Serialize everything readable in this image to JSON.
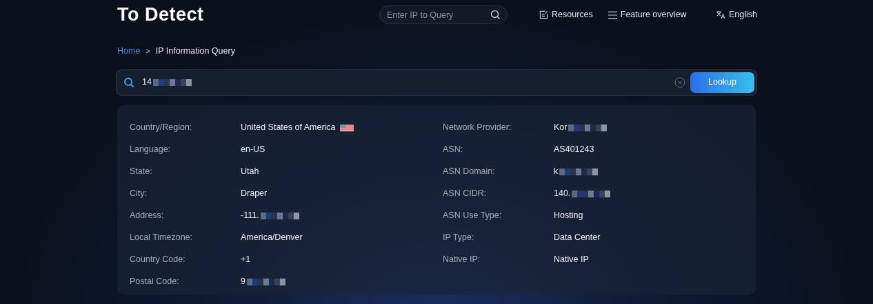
{
  "header": {
    "logo": "To Detect",
    "search": {
      "placeholder": "Enter IP to Query"
    },
    "nav": [
      {
        "kind": "resources",
        "label": "Resources"
      },
      {
        "kind": "menu",
        "label": "Feature overview"
      },
      {
        "kind": "language",
        "label": "English"
      }
    ]
  },
  "breadcrumb": {
    "separator": ">",
    "items": [
      {
        "label": "Home",
        "link": true
      },
      {
        "label": "IP Information Query",
        "link": false
      }
    ]
  },
  "query": {
    "value": "14",
    "redacted": true,
    "button": "Lookup"
  },
  "details": {
    "left": [
      {
        "label": "Country/Region:",
        "value": "United States of America",
        "flag": true,
        "redacted": false
      },
      {
        "label": "Language:",
        "value": "en-US",
        "flag": false,
        "redacted": false
      },
      {
        "label": "State:",
        "value": "Utah",
        "flag": false,
        "redacted": false
      },
      {
        "label": "City:",
        "value": "Draper",
        "flag": false,
        "redacted": false
      },
      {
        "label": "Address:",
        "value": "-111.",
        "flag": false,
        "redacted": true
      },
      {
        "label": "Local Timezone:",
        "value": "America/Denver",
        "flag": false,
        "redacted": false
      },
      {
        "label": "Country Code:",
        "value": "+1",
        "flag": false,
        "redacted": false
      },
      {
        "label": "Postal Code:",
        "value": "9",
        "flag": false,
        "redacted": true
      }
    ],
    "right": [
      {
        "label": "Network Provider:",
        "value": "Kor",
        "flag": false,
        "redacted": true
      },
      {
        "label": "ASN:",
        "value": "AS401243",
        "flag": false,
        "redacted": false
      },
      {
        "label": "ASN Domain:",
        "value": "k",
        "flag": false,
        "redacted": true
      },
      {
        "label": "ASN CIDR:",
        "value": "140.",
        "flag": false,
        "redacted": true
      },
      {
        "label": "ASN Use Type:",
        "value": "Hosting",
        "flag": false,
        "redacted": false
      },
      {
        "label": "IP Type:",
        "value": "Data Center",
        "flag": false,
        "redacted": false
      },
      {
        "label": "Native IP:",
        "value": "Native IP",
        "flag": false,
        "redacted": false
      }
    ]
  }
}
